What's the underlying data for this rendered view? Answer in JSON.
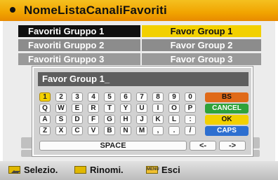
{
  "header": {
    "title": "NomeListaCanaliFavoriti"
  },
  "rows": [
    {
      "name": "Favoriti Gruppo 1",
      "value": "Favor Group 1"
    },
    {
      "name": "Favoriti Gruppo 2",
      "value": "Favor Group 2"
    },
    {
      "name": "Favoriti Gruppo 3",
      "value": "Favor Group 3"
    }
  ],
  "keyboard": {
    "input_value": "Favor Group 1_",
    "rows": [
      [
        "1",
        "2",
        "3",
        "4",
        "5",
        "6",
        "7",
        "8",
        "9",
        "0"
      ],
      [
        "Q",
        "W",
        "E",
        "R",
        "T",
        "Y",
        "U",
        "I",
        "O",
        "P"
      ],
      [
        "A",
        "S",
        "D",
        "F",
        "G",
        "H",
        "J",
        "K",
        "L",
        ":"
      ],
      [
        "Z",
        "X",
        "C",
        "V",
        "B",
        "N",
        "M",
        ",",
        ".",
        "/"
      ]
    ],
    "bs": "BS",
    "cancel": "CANCEL",
    "ok": "OK",
    "caps": "CAPS",
    "space": "SPACE",
    "left": "<-",
    "right": "->"
  },
  "footer": {
    "select_label": "Selezio.",
    "rename_label": "Rinomi.",
    "menu_icon_text": "MENU",
    "exit_label": "Esci"
  },
  "colors": {
    "header": "#f1a400",
    "selected_key": "#f2d000",
    "bs": "#e06a18",
    "cancel": "#2fa23a",
    "ok": "#f2d000",
    "caps": "#2d6fd0"
  }
}
